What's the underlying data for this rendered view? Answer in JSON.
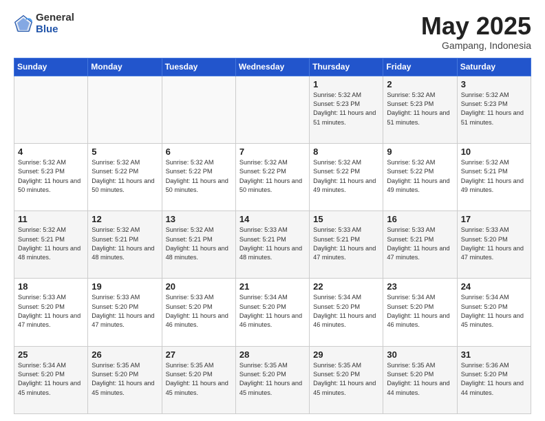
{
  "logo": {
    "general": "General",
    "blue": "Blue"
  },
  "title": "May 2025",
  "location": "Gampang, Indonesia",
  "days_header": [
    "Sunday",
    "Monday",
    "Tuesday",
    "Wednesday",
    "Thursday",
    "Friday",
    "Saturday"
  ],
  "weeks": [
    [
      {
        "num": "",
        "info": ""
      },
      {
        "num": "",
        "info": ""
      },
      {
        "num": "",
        "info": ""
      },
      {
        "num": "",
        "info": ""
      },
      {
        "num": "1",
        "info": "Sunrise: 5:32 AM\nSunset: 5:23 PM\nDaylight: 11 hours\nand 51 minutes."
      },
      {
        "num": "2",
        "info": "Sunrise: 5:32 AM\nSunset: 5:23 PM\nDaylight: 11 hours\nand 51 minutes."
      },
      {
        "num": "3",
        "info": "Sunrise: 5:32 AM\nSunset: 5:23 PM\nDaylight: 11 hours\nand 51 minutes."
      }
    ],
    [
      {
        "num": "4",
        "info": "Sunrise: 5:32 AM\nSunset: 5:23 PM\nDaylight: 11 hours\nand 50 minutes."
      },
      {
        "num": "5",
        "info": "Sunrise: 5:32 AM\nSunset: 5:22 PM\nDaylight: 11 hours\nand 50 minutes."
      },
      {
        "num": "6",
        "info": "Sunrise: 5:32 AM\nSunset: 5:22 PM\nDaylight: 11 hours\nand 50 minutes."
      },
      {
        "num": "7",
        "info": "Sunrise: 5:32 AM\nSunset: 5:22 PM\nDaylight: 11 hours\nand 50 minutes."
      },
      {
        "num": "8",
        "info": "Sunrise: 5:32 AM\nSunset: 5:22 PM\nDaylight: 11 hours\nand 49 minutes."
      },
      {
        "num": "9",
        "info": "Sunrise: 5:32 AM\nSunset: 5:22 PM\nDaylight: 11 hours\nand 49 minutes."
      },
      {
        "num": "10",
        "info": "Sunrise: 5:32 AM\nSunset: 5:21 PM\nDaylight: 11 hours\nand 49 minutes."
      }
    ],
    [
      {
        "num": "11",
        "info": "Sunrise: 5:32 AM\nSunset: 5:21 PM\nDaylight: 11 hours\nand 48 minutes."
      },
      {
        "num": "12",
        "info": "Sunrise: 5:32 AM\nSunset: 5:21 PM\nDaylight: 11 hours\nand 48 minutes."
      },
      {
        "num": "13",
        "info": "Sunrise: 5:32 AM\nSunset: 5:21 PM\nDaylight: 11 hours\nand 48 minutes."
      },
      {
        "num": "14",
        "info": "Sunrise: 5:33 AM\nSunset: 5:21 PM\nDaylight: 11 hours\nand 48 minutes."
      },
      {
        "num": "15",
        "info": "Sunrise: 5:33 AM\nSunset: 5:21 PM\nDaylight: 11 hours\nand 47 minutes."
      },
      {
        "num": "16",
        "info": "Sunrise: 5:33 AM\nSunset: 5:21 PM\nDaylight: 11 hours\nand 47 minutes."
      },
      {
        "num": "17",
        "info": "Sunrise: 5:33 AM\nSunset: 5:20 PM\nDaylight: 11 hours\nand 47 minutes."
      }
    ],
    [
      {
        "num": "18",
        "info": "Sunrise: 5:33 AM\nSunset: 5:20 PM\nDaylight: 11 hours\nand 47 minutes."
      },
      {
        "num": "19",
        "info": "Sunrise: 5:33 AM\nSunset: 5:20 PM\nDaylight: 11 hours\nand 47 minutes."
      },
      {
        "num": "20",
        "info": "Sunrise: 5:33 AM\nSunset: 5:20 PM\nDaylight: 11 hours\nand 46 minutes."
      },
      {
        "num": "21",
        "info": "Sunrise: 5:34 AM\nSunset: 5:20 PM\nDaylight: 11 hours\nand 46 minutes."
      },
      {
        "num": "22",
        "info": "Sunrise: 5:34 AM\nSunset: 5:20 PM\nDaylight: 11 hours\nand 46 minutes."
      },
      {
        "num": "23",
        "info": "Sunrise: 5:34 AM\nSunset: 5:20 PM\nDaylight: 11 hours\nand 46 minutes."
      },
      {
        "num": "24",
        "info": "Sunrise: 5:34 AM\nSunset: 5:20 PM\nDaylight: 11 hours\nand 45 minutes."
      }
    ],
    [
      {
        "num": "25",
        "info": "Sunrise: 5:34 AM\nSunset: 5:20 PM\nDaylight: 11 hours\nand 45 minutes."
      },
      {
        "num": "26",
        "info": "Sunrise: 5:35 AM\nSunset: 5:20 PM\nDaylight: 11 hours\nand 45 minutes."
      },
      {
        "num": "27",
        "info": "Sunrise: 5:35 AM\nSunset: 5:20 PM\nDaylight: 11 hours\nand 45 minutes."
      },
      {
        "num": "28",
        "info": "Sunrise: 5:35 AM\nSunset: 5:20 PM\nDaylight: 11 hours\nand 45 minutes."
      },
      {
        "num": "29",
        "info": "Sunrise: 5:35 AM\nSunset: 5:20 PM\nDaylight: 11 hours\nand 45 minutes."
      },
      {
        "num": "30",
        "info": "Sunrise: 5:35 AM\nSunset: 5:20 PM\nDaylight: 11 hours\nand 44 minutes."
      },
      {
        "num": "31",
        "info": "Sunrise: 5:36 AM\nSunset: 5:20 PM\nDaylight: 11 hours\nand 44 minutes."
      }
    ]
  ]
}
